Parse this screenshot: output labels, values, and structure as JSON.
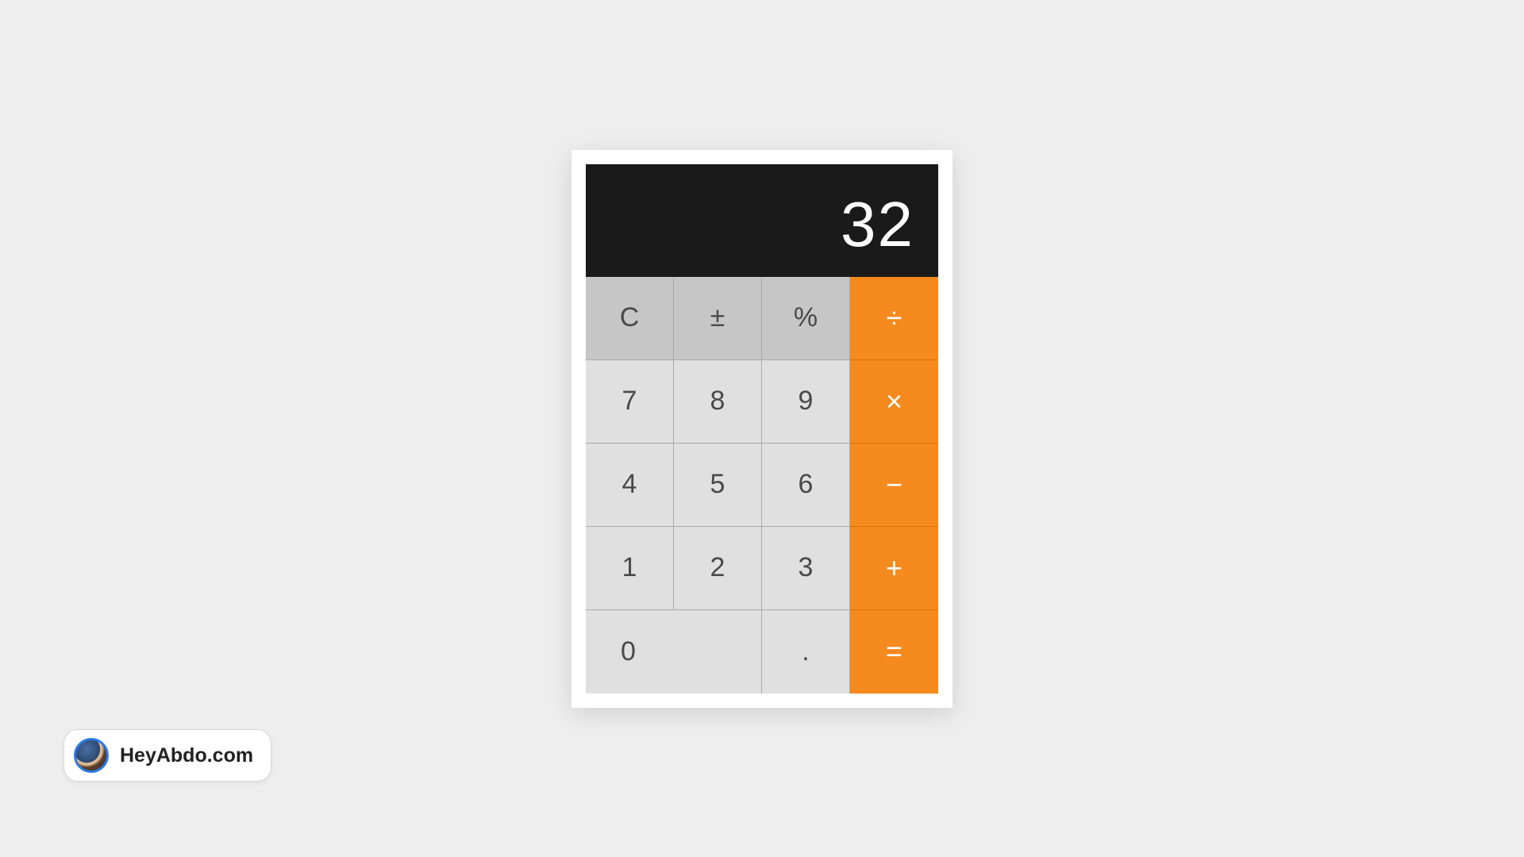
{
  "display": {
    "value": "32"
  },
  "keys": {
    "clear": "C",
    "negate": "±",
    "percent": "%",
    "divide": "÷",
    "seven": "7",
    "eight": "8",
    "nine": "9",
    "multiply": "×",
    "four": "4",
    "five": "5",
    "six": "6",
    "subtract": "−",
    "one": "1",
    "two": "2",
    "three": "3",
    "add": "+",
    "zero": "0",
    "decimal": ".",
    "equals": "="
  },
  "badge": {
    "label": "HeyAbdo.com"
  }
}
